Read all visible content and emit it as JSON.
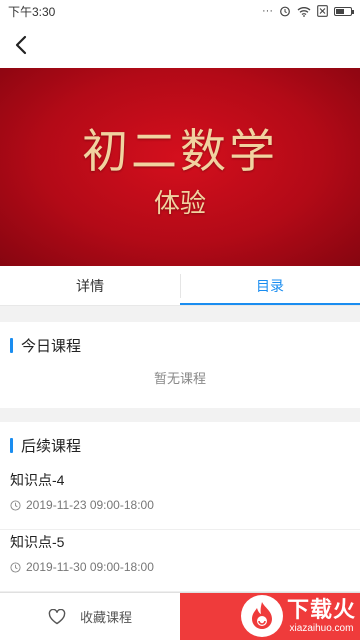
{
  "status_bar": {
    "time": "下午3:30",
    "icons": [
      "dots-icon",
      "alarm-icon",
      "wifi-icon",
      "sim-off-icon",
      "battery-icon"
    ],
    "battery_level": 0.6
  },
  "nav": {
    "back_icon": "chevron-left-icon"
  },
  "banner": {
    "title": "初二数学",
    "subtitle": "体验"
  },
  "tabs": [
    {
      "label": "详情",
      "active": false
    },
    {
      "label": "目录",
      "active": true
    }
  ],
  "today": {
    "title": "今日课程",
    "empty_text": "暂无课程"
  },
  "upcoming": {
    "title": "后续课程",
    "lessons": [
      {
        "title": "知识点-4",
        "time": "2019-11-23 09:00-18:00"
      },
      {
        "title": "知识点-5",
        "time": "2019-11-30 09:00-18:00"
      }
    ]
  },
  "bottom": {
    "favorite_label": "收藏课程"
  },
  "watermark": {
    "text": "下载火",
    "url": "xiazaihuo.com"
  },
  "colors": {
    "accent": "#1a8df0",
    "banner_red": "#c20c1a",
    "banner_text": "#f1d3a0",
    "action_red": "#ef3b3b"
  }
}
